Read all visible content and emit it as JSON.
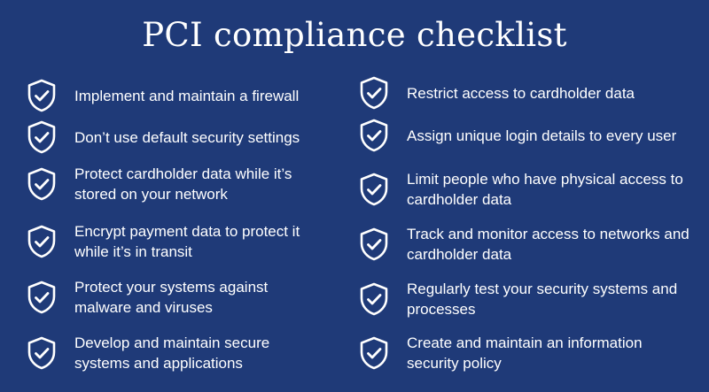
{
  "title": "PCI compliance checklist",
  "icon": "shield-check-icon",
  "colors": {
    "background": "#1f3a78",
    "foreground": "#ffffff"
  },
  "left_items": [
    "Implement and maintain a firewall",
    "Don’t use default security settings",
    "Protect cardholder data while it’s stored on your network",
    "Encrypt payment data to protect it while it’s in transit",
    "Protect your systems against malware and viruses",
    "Develop and maintain secure systems and applications"
  ],
  "right_items": [
    "Restrict access to cardholder data",
    "Assign unique login details to every user",
    "Limit people who have physical access to cardholder data",
    "Track and monitor access to networks and cardholder data",
    "Regularly test your security systems and processes",
    "Create and maintain an information security policy"
  ]
}
